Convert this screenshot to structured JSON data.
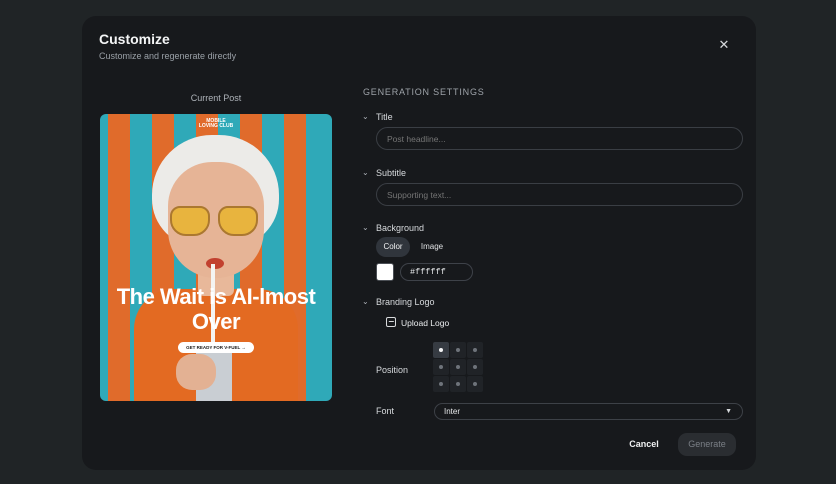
{
  "modal": {
    "title": "Customize",
    "subtitle": "Customize and regenerate directly",
    "close_icon": "close-icon"
  },
  "preview": {
    "label": "Current Post",
    "logo_text": "MOBILE LOVING CLUB",
    "headline": "The Wait is AI-lmost Over",
    "cta": "GET READY FOR V-FUEL →"
  },
  "settings": {
    "section_title": "GENERATION SETTINGS",
    "title": {
      "label": "Title",
      "placeholder": "Post headline..."
    },
    "subtitle": {
      "label": "Subtitle",
      "placeholder": "Supporting text..."
    },
    "background": {
      "label": "Background",
      "tabs": [
        "Color",
        "Image"
      ],
      "active_tab": "Color",
      "color_value": "#ffffff"
    },
    "branding": {
      "label": "Branding Logo",
      "upload_label": "Upload Logo",
      "position_label": "Position",
      "position_selected": "top-left"
    },
    "font": {
      "label": "Font",
      "value": "Inter"
    }
  },
  "footer": {
    "cancel_label": "Cancel",
    "generate_label": "Generate"
  },
  "colors": {
    "modal_bg": "#17191c",
    "poster_stripe_orange": "#e06b2b",
    "poster_stripe_teal": "#2fa9b8"
  }
}
